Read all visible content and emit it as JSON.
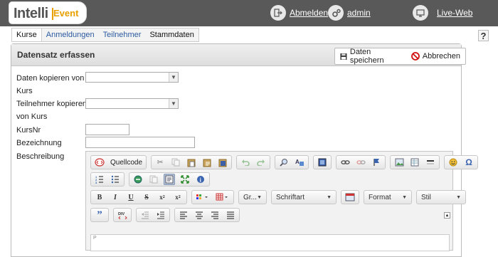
{
  "brand": {
    "intelli": "Intelli",
    "event": "Event"
  },
  "topnav": {
    "logout": "Abmelden",
    "user": "admin",
    "live": "Live-Web"
  },
  "help": "?",
  "tabs": [
    "Kurse",
    "Anmeldungen",
    "Teilnehmer",
    "Stammdaten"
  ],
  "panel": {
    "title": "Datensatz erfassen",
    "save_label": "Daten speichern",
    "cancel_label": "Abbrechen"
  },
  "form": {
    "copy_data_label_1": "Daten kopieren von",
    "copy_data_label_2": "Kurs",
    "copy_participants_label_1": "Teilnehmer kopieren",
    "copy_participants_label_2": "von Kurs",
    "kursnr_label": "KursNr",
    "bezeichnung_label": "Bezeichnung",
    "beschreibung_label": "Beschreibung"
  },
  "editor": {
    "source_label": "Quellcode",
    "styles_combo": "Gr...",
    "font_combo": "Schriftart",
    "format_combo": "Format",
    "stil_combo": "Stil",
    "path_tag": "P"
  },
  "colors": {
    "topbar": "#595959",
    "accent": "#e8a000",
    "link": "#2c5aa0"
  }
}
